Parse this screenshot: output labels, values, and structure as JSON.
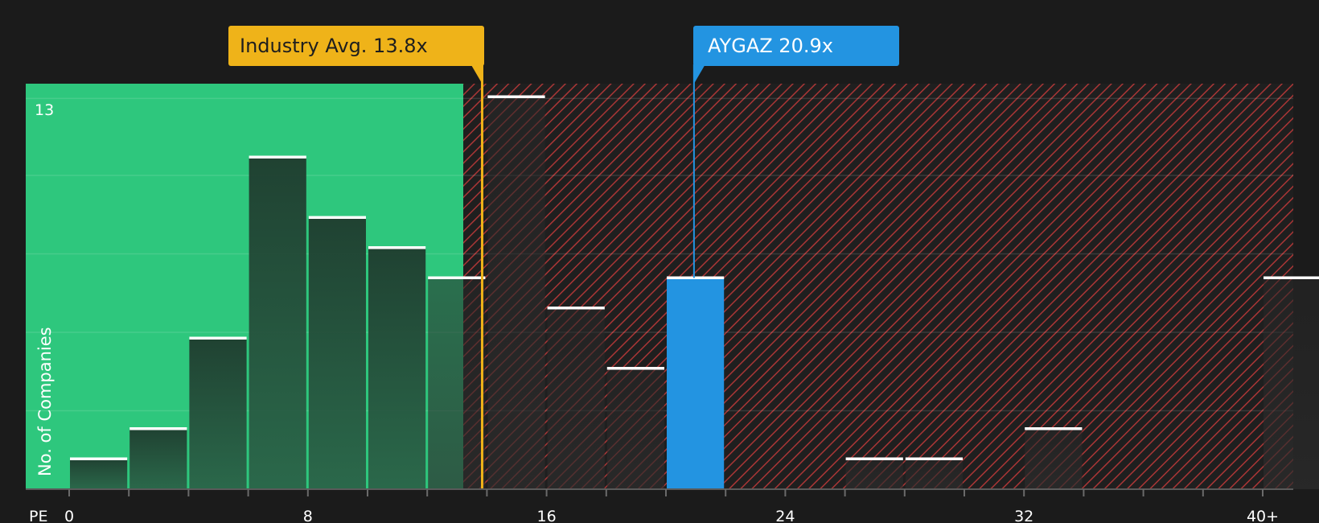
{
  "colors": {
    "background": "#1b1b1b",
    "undervalued_zone": "#2ec77d",
    "overvalued_zone": "#c33a3a",
    "industry": "#efb319",
    "company": "#2394e1",
    "bar_fill": "#1f3b2e",
    "bar_cap": "#ffffff"
  },
  "callouts": {
    "industry": "Industry Avg. 13.8x",
    "company": "AYGAZ 20.9x"
  },
  "chart_data": {
    "type": "bar",
    "xlabel": "PE",
    "ylabel": "No. of Companies",
    "ymax_label": "13",
    "ylim": [
      0,
      13.5
    ],
    "xlim": [
      -1.4,
      41
    ],
    "x_ticks": [
      0,
      8,
      16,
      24,
      32,
      40
    ],
    "x_tick_labels": [
      "0",
      "8",
      "16",
      "24",
      "32",
      "40+"
    ],
    "minor_ticks": [
      2,
      4,
      6,
      10,
      12,
      14,
      18,
      20,
      22,
      26,
      28,
      30,
      34,
      36,
      38
    ],
    "bin_width": 2,
    "industry_avg": 13.8,
    "company_pe": 20.9,
    "bins": [
      {
        "start": 0,
        "count": 1
      },
      {
        "start": 2,
        "count": 2
      },
      {
        "start": 4,
        "count": 5
      },
      {
        "start": 6,
        "count": 11
      },
      {
        "start": 8,
        "count": 9
      },
      {
        "start": 10,
        "count": 8
      },
      {
        "start": 12,
        "count": 7
      },
      {
        "start": 14,
        "count": 13
      },
      {
        "start": 16,
        "count": 6
      },
      {
        "start": 18,
        "count": 4
      },
      {
        "start": 20,
        "count": 7,
        "highlight": true
      },
      {
        "start": 26,
        "count": 1
      },
      {
        "start": 28,
        "count": 1
      },
      {
        "start": 32,
        "count": 2
      },
      {
        "start": 40,
        "count": 7
      }
    ]
  }
}
